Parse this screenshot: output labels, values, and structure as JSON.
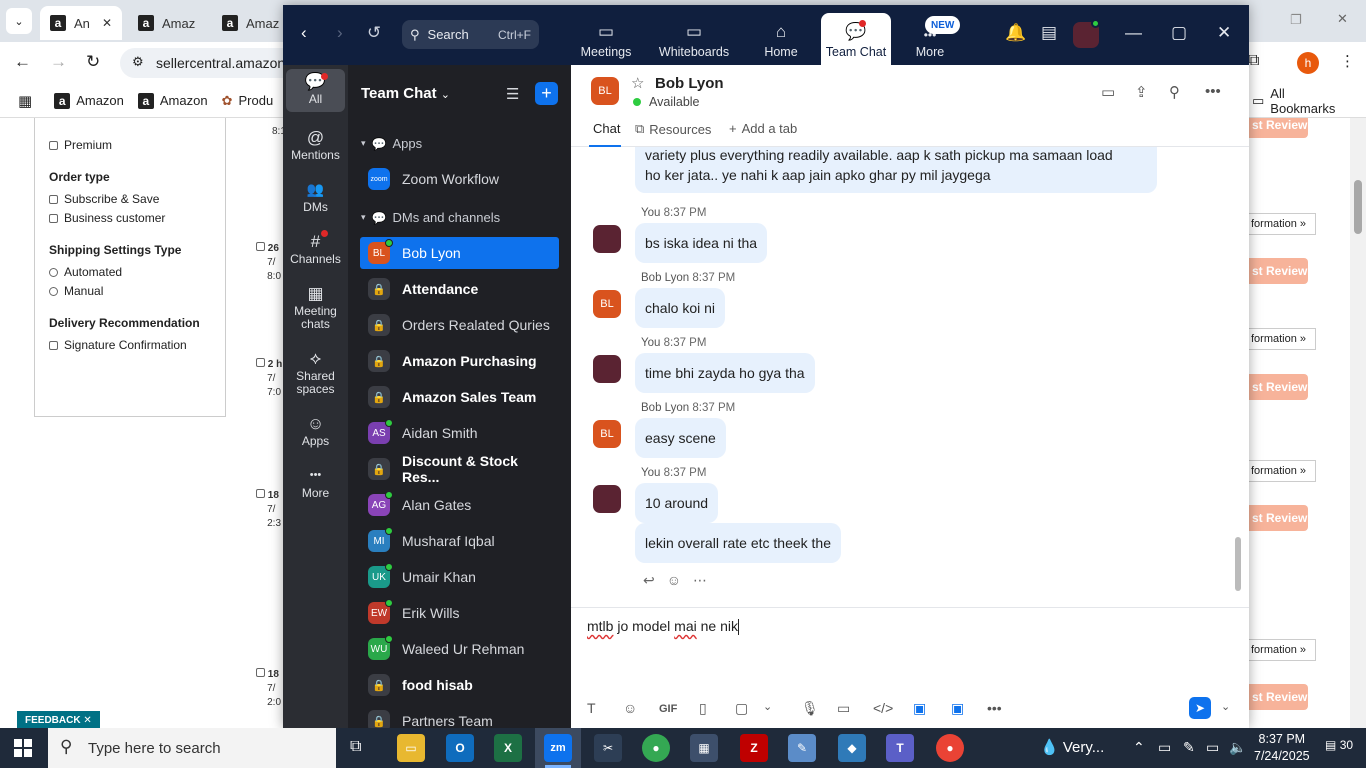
{
  "browser": {
    "tabs": [
      {
        "label": "An",
        "close": "✕"
      },
      {
        "label": "Amaz"
      },
      {
        "label": "Amaz"
      }
    ],
    "url": "sellercentral.amazon",
    "bookmarks": [
      "Amazon",
      "Amazon",
      "Produ"
    ],
    "all_bookmarks": "All Bookmarks",
    "profile_initial": "h"
  },
  "seller_page": {
    "premium": "Premium",
    "order_type_title": "Order type",
    "order_type_opts": [
      "Subscribe & Save",
      "Business customer"
    ],
    "shipping_title": "Shipping Settings Type",
    "shipping_opts": [
      "Automated",
      "Manual"
    ],
    "delivery_title": "Delivery Recommendation",
    "delivery_opts": [
      "Signature Confirmation"
    ],
    "rows": [
      {
        "a": "8:1"
      },
      {
        "a": "26",
        "b": "7/",
        "c": "8:0"
      },
      {
        "a": "2 h",
        "b": "7/",
        "c": "7:0"
      },
      {
        "a": "18",
        "b": "7/",
        "c": "2:3"
      },
      {
        "a": "18",
        "b": "7/",
        "c": "2:0"
      }
    ],
    "review_btn": "st Review",
    "info_link": "formation »",
    "feedback": "FEEDBACK ✕"
  },
  "zoom": {
    "search": {
      "label": "Search",
      "shortcut": "Ctrl+F"
    },
    "nav_tabs": [
      {
        "label": "Meetings",
        "icon": "▭"
      },
      {
        "label": "Whiteboards",
        "icon": "▭"
      },
      {
        "label": "Home",
        "icon": "⌂"
      },
      {
        "label": "Team Chat",
        "icon": "💬"
      },
      {
        "label": "More",
        "icon": "•••"
      }
    ],
    "new_badge": "NEW",
    "rail": [
      {
        "label": "All",
        "icon": "💬"
      },
      {
        "label": "Mentions",
        "icon": "@"
      },
      {
        "label": "DMs",
        "icon": "👥"
      },
      {
        "label": "Channels",
        "icon": "#"
      },
      {
        "label": "Meeting chats",
        "icon": "▦"
      },
      {
        "label": "Shared spaces",
        "icon": "⟡"
      },
      {
        "label": "Apps",
        "icon": "☺"
      },
      {
        "label": "More",
        "icon": "•••"
      }
    ],
    "list": {
      "title": "Team Chat",
      "apps_section": "Apps",
      "zoom_workflow": "Zoom Workflow",
      "zoom_logo": "zoom",
      "dm_section": "DMs and channels",
      "items": [
        {
          "name": "Bob Lyon",
          "initials": "BL",
          "color": "#d9531e",
          "type": "dm",
          "active": true
        },
        {
          "name": "Attendance",
          "type": "channel",
          "bold": true
        },
        {
          "name": "Orders Realated Quries",
          "type": "channel"
        },
        {
          "name": "Amazon Purchasing",
          "type": "channel",
          "bold": true
        },
        {
          "name": "Amazon Sales Team",
          "type": "channel",
          "bold": true
        },
        {
          "name": "Aidan Smith",
          "initials": "AS",
          "color": "#7a3fb0",
          "type": "dm"
        },
        {
          "name": "Discount & Stock Res...",
          "type": "channel",
          "bold": true
        },
        {
          "name": "Alan Gates",
          "initials": "AG",
          "color": "#8a44b8",
          "type": "dm"
        },
        {
          "name": "Musharaf Iqbal",
          "initials": "MI",
          "color": "#2a7fbf",
          "type": "dm"
        },
        {
          "name": "Umair Khan",
          "initials": "UK",
          "color": "#1a9a8a",
          "type": "dm"
        },
        {
          "name": "Erik Wills",
          "initials": "EW",
          "color": "#c0392b",
          "type": "dm"
        },
        {
          "name": "Waleed Ur Rehman",
          "initials": "WU",
          "color": "#2aa84a",
          "type": "dm"
        },
        {
          "name": "food hisab",
          "type": "channel",
          "bold": true
        },
        {
          "name": "Partners Team",
          "type": "channel"
        }
      ]
    },
    "chat": {
      "name": "Bob Lyon",
      "initials": "BL",
      "status": "Available",
      "tabs": [
        "Chat",
        "Resources",
        "Add a tab"
      ],
      "messages": [
        {
          "who": "bl",
          "sender": "",
          "time": "",
          "text": "variety plus everything readily available. aap k sath pickup ma samaan load",
          "text2": "ho ker jata.. ye nahi k aap jain apko ghar py mil jaygega"
        },
        {
          "who": "me",
          "sender": "You",
          "time": "8:37 PM",
          "text": "bs iska idea ni tha"
        },
        {
          "who": "bl",
          "sender": "Bob Lyon",
          "time": "8:37 PM",
          "text": "chalo koi ni"
        },
        {
          "who": "me",
          "sender": "You",
          "time": "8:37 PM",
          "text": "time bhi zayda ho gya tha"
        },
        {
          "who": "bl",
          "sender": "Bob Lyon",
          "time": "8:37 PM",
          "text": "easy scene"
        },
        {
          "who": "me",
          "sender": "You",
          "time": "8:37 PM",
          "text": "10 around"
        },
        {
          "who": "me",
          "sender": "",
          "time": "",
          "text": "lekin overall rate etc theek the"
        }
      ],
      "composer": {
        "w1": "mtlb",
        "w2": " jo model ",
        "w3": "mai",
        "w4": " ne nik"
      }
    }
  },
  "taskbar": {
    "search_placeholder": "Type here to search",
    "weather": "Very...",
    "time": "8:37 PM",
    "date": "7/24/2025",
    "notifications": "30"
  }
}
